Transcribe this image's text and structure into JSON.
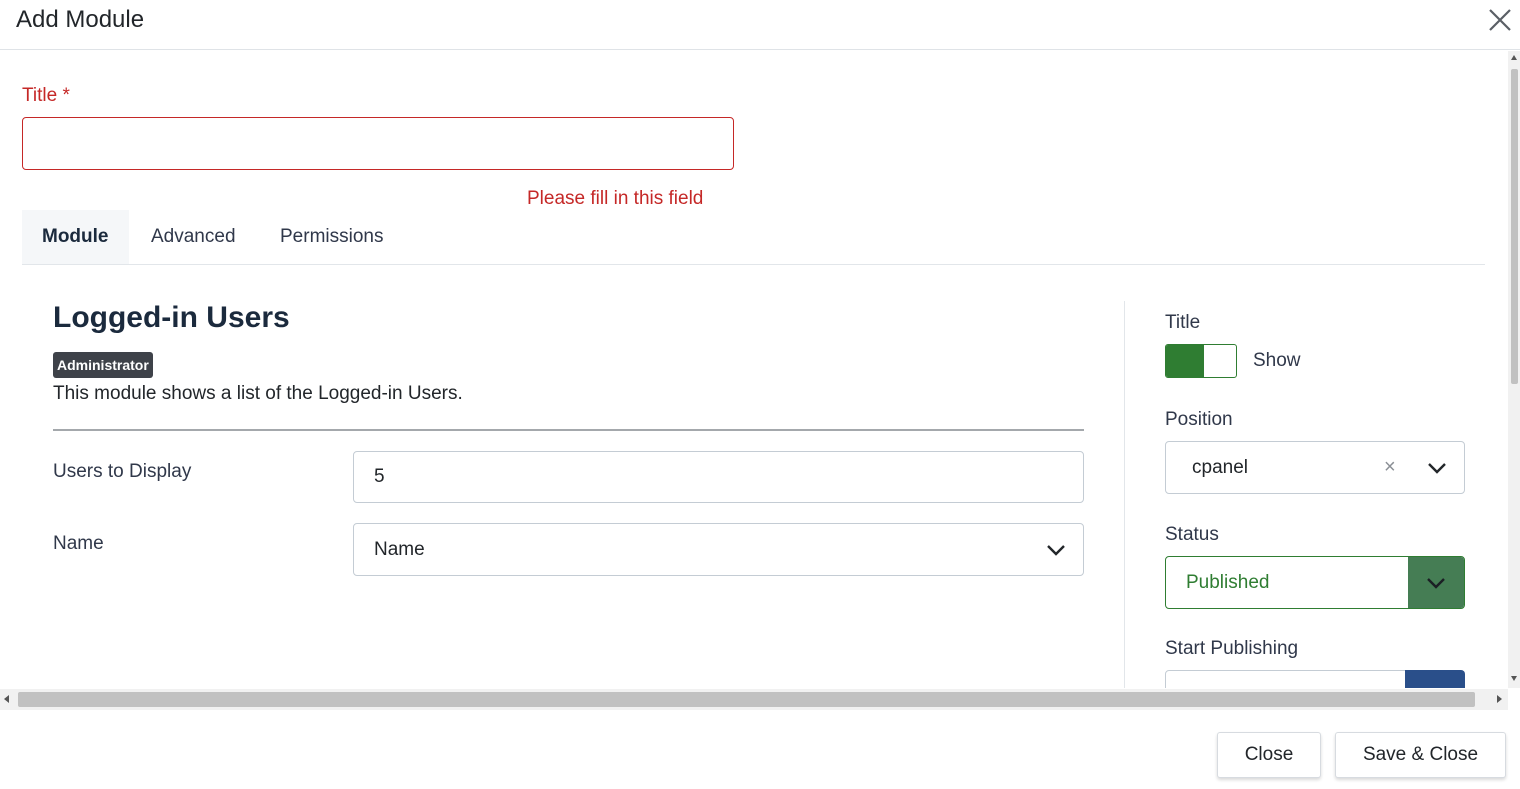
{
  "modal": {
    "title": "Add Module",
    "close_icon": "close-icon"
  },
  "form": {
    "title_label": "Title *",
    "title_value": "",
    "title_error": "Please fill in this field"
  },
  "tabs": [
    {
      "label": "Module",
      "active": true
    },
    {
      "label": "Advanced",
      "active": false
    },
    {
      "label": "Permissions",
      "active": false
    }
  ],
  "module": {
    "heading": "Logged-in Users",
    "badge": "Administrator",
    "description": "This module shows a list of the Logged-in Users."
  },
  "params": {
    "users_to_display_label": "Users to Display",
    "users_to_display_value": "5",
    "name_label": "Name",
    "name_value": "Name"
  },
  "side": {
    "title_label": "Title",
    "title_toggle_text": "Show",
    "position_label": "Position",
    "position_value": "cpanel",
    "position_clear": "×",
    "status_label": "Status",
    "status_value": "Published",
    "start_publishing_label": "Start Publishing"
  },
  "footer": {
    "close_label": "Close",
    "save_close_label": "Save & Close"
  },
  "colors": {
    "error": "#c52827",
    "success": "#2f7d32",
    "status_arrow": "#457d54",
    "primary": "#2a4f8a"
  }
}
